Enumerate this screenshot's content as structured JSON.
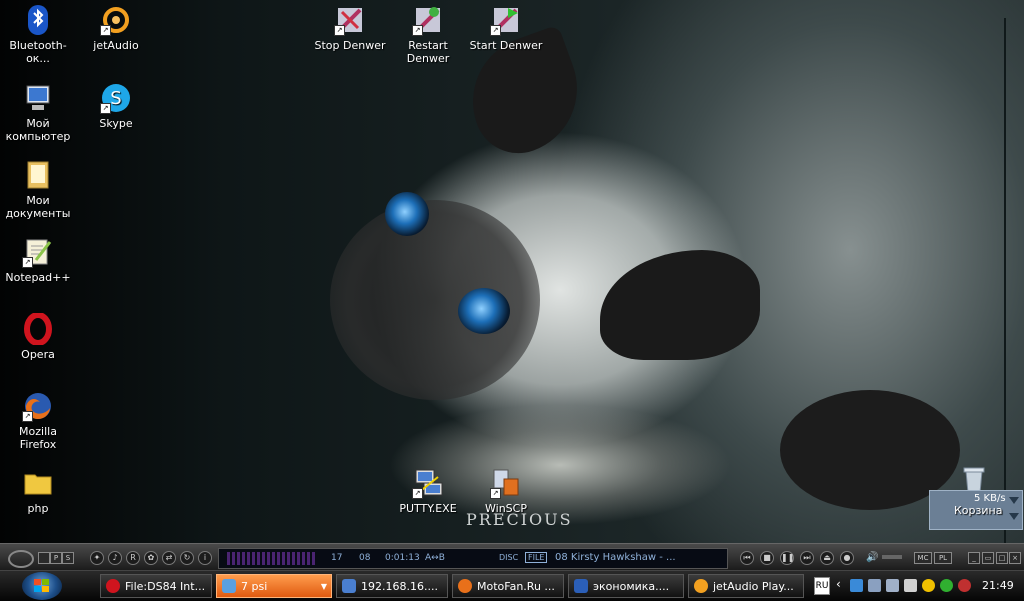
{
  "desktop": {
    "icons": [
      {
        "id": "bluetooth",
        "label": "Bluetooth-ок...",
        "icon": "bluetooth-icon",
        "color": "#1a56c8"
      },
      {
        "id": "jetaudio",
        "label": "jetAudio",
        "icon": "jetaudio-icon",
        "color": "#f2a020"
      },
      {
        "id": "stop-denwer",
        "label": "Stop Denwer",
        "icon": "denwer-icon",
        "color": "#b03060"
      },
      {
        "id": "restart-denwer",
        "label": "Restart Denwer",
        "icon": "denwer-icon",
        "color": "#b03060"
      },
      {
        "id": "start-denwer",
        "label": "Start Denwer",
        "icon": "denwer-icon",
        "color": "#b03060"
      },
      {
        "id": "my-computer",
        "label": "Мой компьютер",
        "icon": "computer-icon",
        "color": "#3c78d0"
      },
      {
        "id": "skype",
        "label": "Skype",
        "icon": "skype-icon",
        "color": "#1ea7e8"
      },
      {
        "id": "my-documents",
        "label": "Мои документы",
        "icon": "folder-icon",
        "color": "#e8c060"
      },
      {
        "id": "notepadpp",
        "label": "Notepad++",
        "icon": "notepad-icon",
        "color": "#8bc34a"
      },
      {
        "id": "opera",
        "label": "Opera",
        "icon": "opera-icon",
        "color": "#d0141e"
      },
      {
        "id": "firefox",
        "label": "Mozilla Firefox",
        "icon": "firefox-icon",
        "color": "#e8701a"
      },
      {
        "id": "php",
        "label": "php",
        "icon": "folder-icon",
        "color": "#f0c840"
      },
      {
        "id": "putty",
        "label": "PUTTY.EXE",
        "icon": "putty-icon",
        "color": "#4a7fd0"
      },
      {
        "id": "winscp",
        "label": "WinSCP",
        "icon": "winscp-icon",
        "color": "#e07020"
      },
      {
        "id": "recycle",
        "label": "Корзина",
        "icon": "recycle-bin-icon",
        "color": "#c8d4de"
      }
    ],
    "wallpaper_text": "PRECIOUS",
    "netmon": {
      "speed": "5 KB/s"
    }
  },
  "player": {
    "track_no": "17",
    "track_total": "08",
    "time": "0:01:13",
    "ab": "A↔B",
    "disc": "DISC",
    "file": "FILE",
    "title": "08 Kirsty Hawkshaw - ...",
    "mc": "MC",
    "pl": "PL"
  },
  "taskbar": {
    "tasks": [
      {
        "label": "File:DS84 Int...",
        "icon": "opera-icon",
        "color": "#d0141e",
        "active": false
      },
      {
        "label": "7 psi",
        "icon": "psi-icon",
        "color": "#5aa0e0",
        "active": true
      },
      {
        "label": "192.168.16....",
        "icon": "putty-icon",
        "color": "#4a7fd0",
        "active": false
      },
      {
        "label": "MotoFan.Ru ...",
        "icon": "firefox-icon",
        "color": "#e8701a",
        "active": false
      },
      {
        "label": "экономика....",
        "icon": "word-icon",
        "color": "#2b5fb8",
        "active": false
      },
      {
        "label": "jetAudio Play...",
        "icon": "jetaudio-icon",
        "color": "#f2a020",
        "active": false
      }
    ],
    "lang": "RU",
    "clock": "21:49",
    "start_icon": "windows-logo-icon"
  }
}
